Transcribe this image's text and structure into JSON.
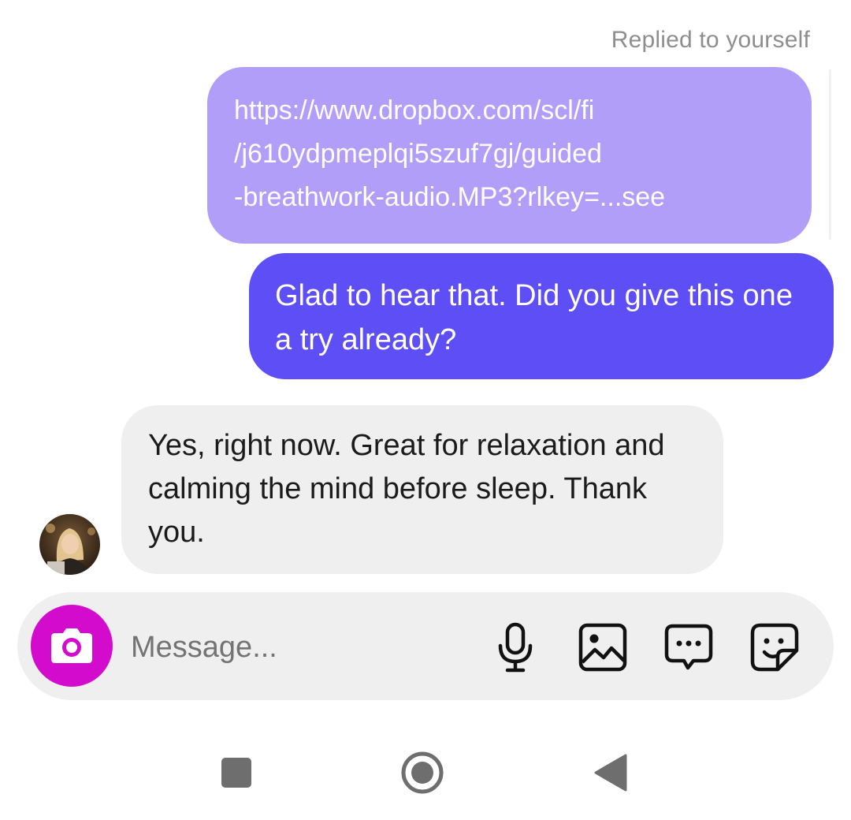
{
  "thread": {
    "reply_context": "Replied to yourself",
    "quoted_message": {
      "lines": [
        "https://www.dropbox.com/scl/fi",
        "/j610ydpmeplqi5szuf7gj/guided",
        "-breathwork-audio.MP3?rlkey=...see"
      ]
    },
    "sent_message": {
      "text": "Glad to hear that. Did you give this one a try already?"
    },
    "received_message": {
      "text": "Yes, right now. Great for relaxation and calming the mind before sleep. Thank you."
    }
  },
  "composer": {
    "placeholder": "Message...",
    "camera_icon": "camera-icon",
    "tools": [
      "microphone-icon",
      "gallery-icon",
      "chat-bubble-icon",
      "sticker-icon"
    ]
  },
  "colors": {
    "quoted_bubble": "#b19ef8",
    "sent_bubble": "#5e4ef5",
    "received_bubble": "#efefef",
    "camera_button": "#d30bcd"
  },
  "nav": {
    "icons": [
      "recents-icon",
      "home-icon",
      "back-icon"
    ]
  }
}
